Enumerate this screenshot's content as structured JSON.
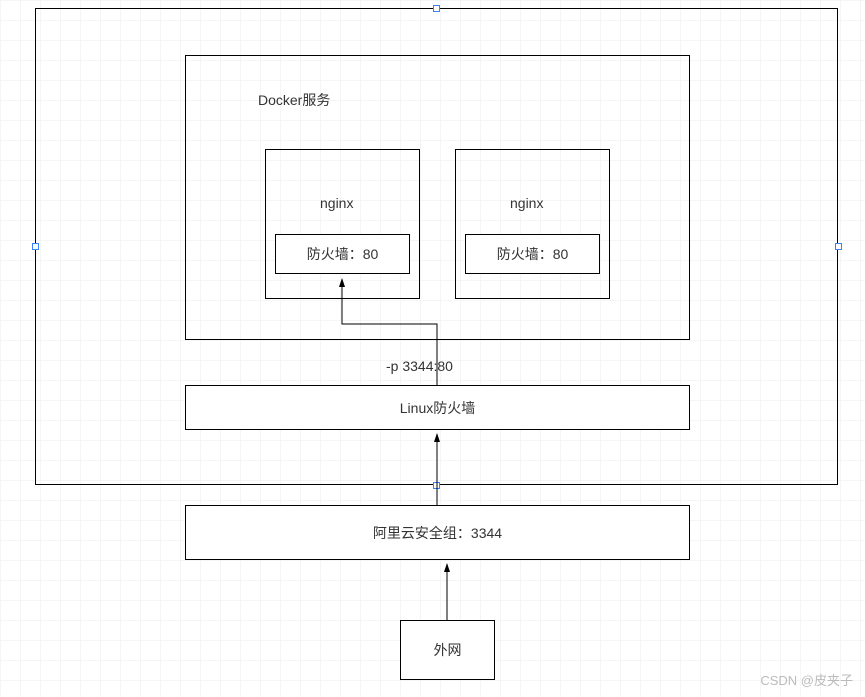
{
  "outer": {
    "docker_label": "Docker服务",
    "nginx1": {
      "title": "nginx",
      "fw": "防火墙：80"
    },
    "nginx2": {
      "title": "nginx",
      "fw": "防火墙：80"
    },
    "port_map": "-p 3344:80",
    "linux_fw": "Linux防火墙"
  },
  "aliyun": "阿里云安全组：3344",
  "extnet": "外网",
  "watermark": "CSDN @皮夹子"
}
